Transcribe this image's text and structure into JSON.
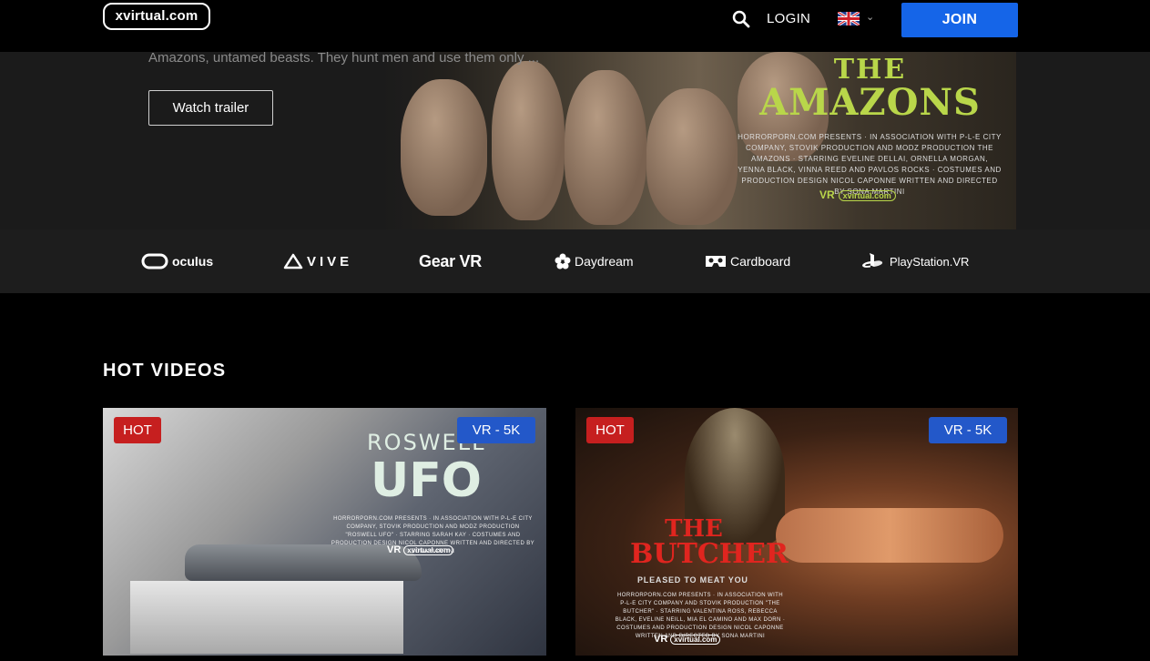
{
  "header": {
    "logo": "xvirtual.com",
    "login_label": "LOGIN",
    "language": "en-GB",
    "join_label": "JOIN"
  },
  "hero": {
    "description": "Amazons, untamed beasts. They hunt men and use them only ...",
    "watch_trailer_label": "Watch trailer",
    "poster_title_line1": "THE",
    "poster_title_line2": "AMAZONS",
    "poster_credits": "HORRORPORN.COM PRESENTS · IN ASSOCIATION WITH P-L-E CITY COMPANY, STOVIK PRODUCTION AND MODZ PRODUCTION THE AMAZONS · STARRING EVELINE DELLAI, ORNELLA MORGAN, YENNA BLACK, VINNA REED AND PAVLOS ROCKS · COSTUMES AND PRODUCTION DESIGN NICOL CAPONNE WRITTEN AND DIRECTED BY SONA MARTINI",
    "poster_badge": "VR",
    "poster_badge_site": "xvirtual.com"
  },
  "platforms": [
    {
      "name": "oculus",
      "icon": "oculus-icon"
    },
    {
      "name": "VIVE",
      "icon": "vive-icon"
    },
    {
      "name": "Gear VR",
      "icon": "gearvr-icon"
    },
    {
      "name": "Daydream",
      "icon": "daydream-icon"
    },
    {
      "name": "Cardboard",
      "icon": "cardboard-icon"
    },
    {
      "name": "PlayStation.VR",
      "icon": "playstation-icon"
    }
  ],
  "hot_videos": {
    "title": "HOT VIDEOS",
    "items": [
      {
        "badge_hot": "HOT",
        "badge_vr": "VR - 5K",
        "poster_title_line1": "ROSWELL",
        "poster_title_line2": "UFO",
        "poster_credits": "HORRORPORN.COM PRESENTS · IN ASSOCIATION WITH P-L-E CITY COMPANY, STOVIK PRODUCTION AND MODZ PRODUCTION \"ROSWELL UFO\" · STARRING SARAH KAY · COSTUMES AND PRODUCTION DESIGN NICOL CAPONNE WRITTEN AND DIRECTED BY SONA MARTINI",
        "poster_badge": "VR",
        "poster_badge_site": "xvirtual.com"
      },
      {
        "badge_hot": "HOT",
        "badge_vr": "VR - 5K",
        "poster_title_line1": "THE",
        "poster_title_line2": "BUTCHER",
        "poster_tagline": "PLEASED TO MEAT YOU",
        "poster_credits": "HORRORPORN.COM PRESENTS · IN ASSOCIATION WITH P-L-E CITY COMPANY AND STOVIK PRODUCTION \"THE BUTCHER\" · STARRING VALENTINA ROSS, REBECCA BLACK, EVELINE NEILL, MIA EL CAMINO AND MAX DORN · COSTUMES AND PRODUCTION DESIGN NICOL CAPONNE WRITTEN AND DIRECTED BY SONA MARTINI",
        "poster_badge": "VR",
        "poster_badge_site": "xvirtual.com"
      }
    ]
  },
  "colors": {
    "join_button": "#1565e8",
    "hot_badge": "#c61f1f",
    "vr_badge": "#2358c9",
    "poster_green": "#b9d64a"
  }
}
